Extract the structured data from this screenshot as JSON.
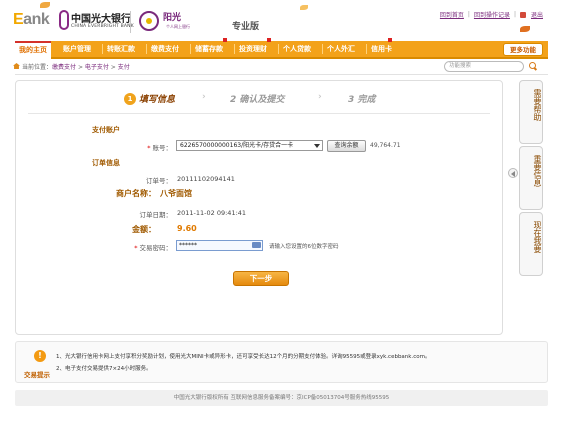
{
  "header": {
    "logo_text": "ank",
    "logo_letter": "E",
    "bank_name_cn": "中国光大银行",
    "bank_name_en": "CHINA EVERBRIGHT BANK",
    "product_name": "阳光",
    "product_sub": "个人网上银行",
    "edition": "专业版",
    "links": [
      "回到首页",
      "回到操作记录",
      "退出"
    ]
  },
  "nav": {
    "items": [
      "我的主页",
      "账户管理",
      "转账汇款",
      "缴费支付",
      "储蓄存款",
      "投资理财",
      "个人贷款",
      "个人外汇",
      "信用卡"
    ],
    "active_index": 0,
    "more_label": "更多功能"
  },
  "breadcrumb": {
    "prefix": "当前位置：",
    "items": [
      "缴费支付",
      "电子支付",
      "支付"
    ],
    "search_placeholder": "功能搜索"
  },
  "steps": [
    {
      "num": "1",
      "label": "填写信息",
      "active": true
    },
    {
      "num": "2",
      "label": "确认及提交",
      "active": false
    },
    {
      "num": "3",
      "label": "完成",
      "active": false
    }
  ],
  "form": {
    "section_account": "支付账户",
    "account_label": "账号：",
    "account_value": "6226570000000163/阳光卡/存贷合一卡",
    "balance_button": "查询余额",
    "balance_value": "49,764.71",
    "section_order": "订单信息",
    "order_no_label": "订单号：",
    "order_no_value": "20111102094141",
    "merchant_label": "商户名称：",
    "merchant_value": "八爷面馆",
    "order_date_label": "订单日期：",
    "order_date_value": "2011-11-02 09:41:41",
    "amount_label": "金额：",
    "amount_value": "9.60",
    "password_label": "交易密码：",
    "password_value": "******",
    "password_hint": "请输入您设置的6位数字密码",
    "next_button": "下一步"
  },
  "side_tabs": [
    "需要帮助",
    "重要信息",
    "现在我要"
  ],
  "tips": {
    "title": "交易提示",
    "lines": [
      "1、光大银行信用卡网上支付享积分奖励计划，使用光大MINI卡或异形卡，还可享受长达12个月的分期支付体验。详询95595或登录xyk.cebbank.com。",
      "2、电子支付交易提供7×24小时服务。"
    ]
  },
  "footer": "中国光大银行版权所有  互联网信息服务备案编号：京ICP备05013704号服务热线95595",
  "colors": {
    "nav_orange": "#f3a21a",
    "brand_purple": "#7a2a7c",
    "label_brown": "#a05a00",
    "amount_orange": "#e07a00"
  }
}
